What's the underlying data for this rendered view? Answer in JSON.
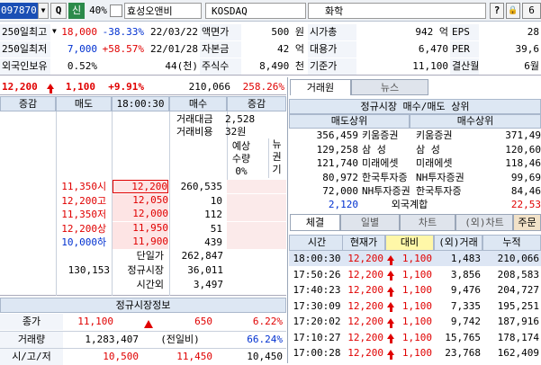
{
  "toolbar": {
    "code": "097870",
    "search_glyph": "Q",
    "badge": "신",
    "pct": "40%",
    "name": "효성오앤비",
    "market": "KOSDAQ",
    "sector": "화학",
    "help": "?",
    "lock": "🔒",
    "num": "6"
  },
  "info": [
    [
      "250일최고",
      "18,000",
      "-38.33%",
      "22/03/22",
      "액면가",
      "500 원",
      "시가총",
      "942 억",
      "EPS",
      "28"
    ],
    [
      "250일최저",
      "7,000",
      "+58.57%",
      "22/01/28",
      "자본금",
      "42 억",
      "대용가",
      "6,470",
      "PER",
      "39,6"
    ],
    [
      "외국인보유",
      "0.52%",
      "",
      "44(천)",
      "주식수",
      "8,490 천",
      "기준가",
      "11,100",
      "결산월",
      "6월"
    ]
  ],
  "quote": {
    "price": "12,200",
    "change": "1,100",
    "rate": "+9.91%",
    "volume": "210,066",
    "ratio": "258.26%"
  },
  "ob_headers": [
    "증감",
    "매도",
    "18:00:30",
    "매수",
    "증감"
  ],
  "ob_side": {
    "amt_label": "거래대금",
    "amt_value": "2,528",
    "cost_label": "거래비용",
    "cost_value": "32원",
    "exp_label": "예상",
    "qty_label": "수량",
    "zero": "0%",
    "news": "뉴권기"
  },
  "ob_rows": [
    [
      "11,350",
      "시",
      "12,200",
      "260,535"
    ],
    [
      "12,200",
      "고",
      "12,050",
      "10"
    ],
    [
      "11,350",
      "저",
      "12,000",
      "112"
    ],
    [
      "12,200",
      "상",
      "11,950",
      "51"
    ],
    [
      "10,000",
      "하",
      "11,900",
      "439"
    ]
  ],
  "ob_summary": {
    "sell_total": "130,153",
    "single_label": "단일가",
    "single_val": "262,847",
    "reg_label": "정규시장",
    "reg_val": "36,011",
    "after_label": "시간외",
    "after_val": "3,497"
  },
  "regular": {
    "title": "정규시장정보",
    "close_label": "종가",
    "close": "11,100",
    "close_chg": "650",
    "close_rate": "6.22%",
    "vol_label": "거래량",
    "vol": "1,283,407",
    "prev_label": "(전일비)",
    "prev_rate": "66.24%",
    "ohl_label": "시/고/저",
    "o": "10,500",
    "h": "11,450",
    "l": "10,450"
  },
  "tabs_top": [
    "거래원",
    "뉴스"
  ],
  "broker": {
    "title": "정규시장 매수/매도 상위",
    "sell_h": "매도상위",
    "buy_h": "매수상위",
    "rows": [
      [
        "356,459",
        "키움증권",
        "키움증권",
        "371,49"
      ],
      [
        "129,258",
        "삼   성",
        "삼   성",
        "120,60"
      ],
      [
        "121,740",
        "미래에셋",
        "미래에셋",
        "118,46"
      ],
      [
        "80,972",
        "한국투자증",
        "NH투자증권",
        "99,69"
      ],
      [
        "72,000",
        "NH투자증권",
        "한국투자증",
        "84,46"
      ]
    ],
    "foreign_sell": "2,120",
    "foreign_label": "외국계합",
    "foreign_buy": "22,53"
  },
  "tabs_bottom": [
    "체결",
    "일별",
    "차트",
    "(외)차트",
    "주문"
  ],
  "trade_headers": [
    "시간",
    "현재가",
    "대비",
    "(외)거래량",
    "누적"
  ],
  "trades": [
    [
      "18:00:30",
      "12,200",
      "1,100",
      "1,483",
      "210,066"
    ],
    [
      "17:50:26",
      "12,200",
      "1,100",
      "3,856",
      "208,583"
    ],
    [
      "17:40:23",
      "12,200",
      "1,100",
      "9,476",
      "204,727"
    ],
    [
      "17:30:09",
      "12,200",
      "1,100",
      "7,335",
      "195,251"
    ],
    [
      "17:20:02",
      "12,200",
      "1,100",
      "9,742",
      "187,916"
    ],
    [
      "17:10:27",
      "12,200",
      "1,100",
      "15,765",
      "178,174"
    ],
    [
      "17:00:28",
      "12,200",
      "1,100",
      "23,768",
      "162,409"
    ]
  ]
}
